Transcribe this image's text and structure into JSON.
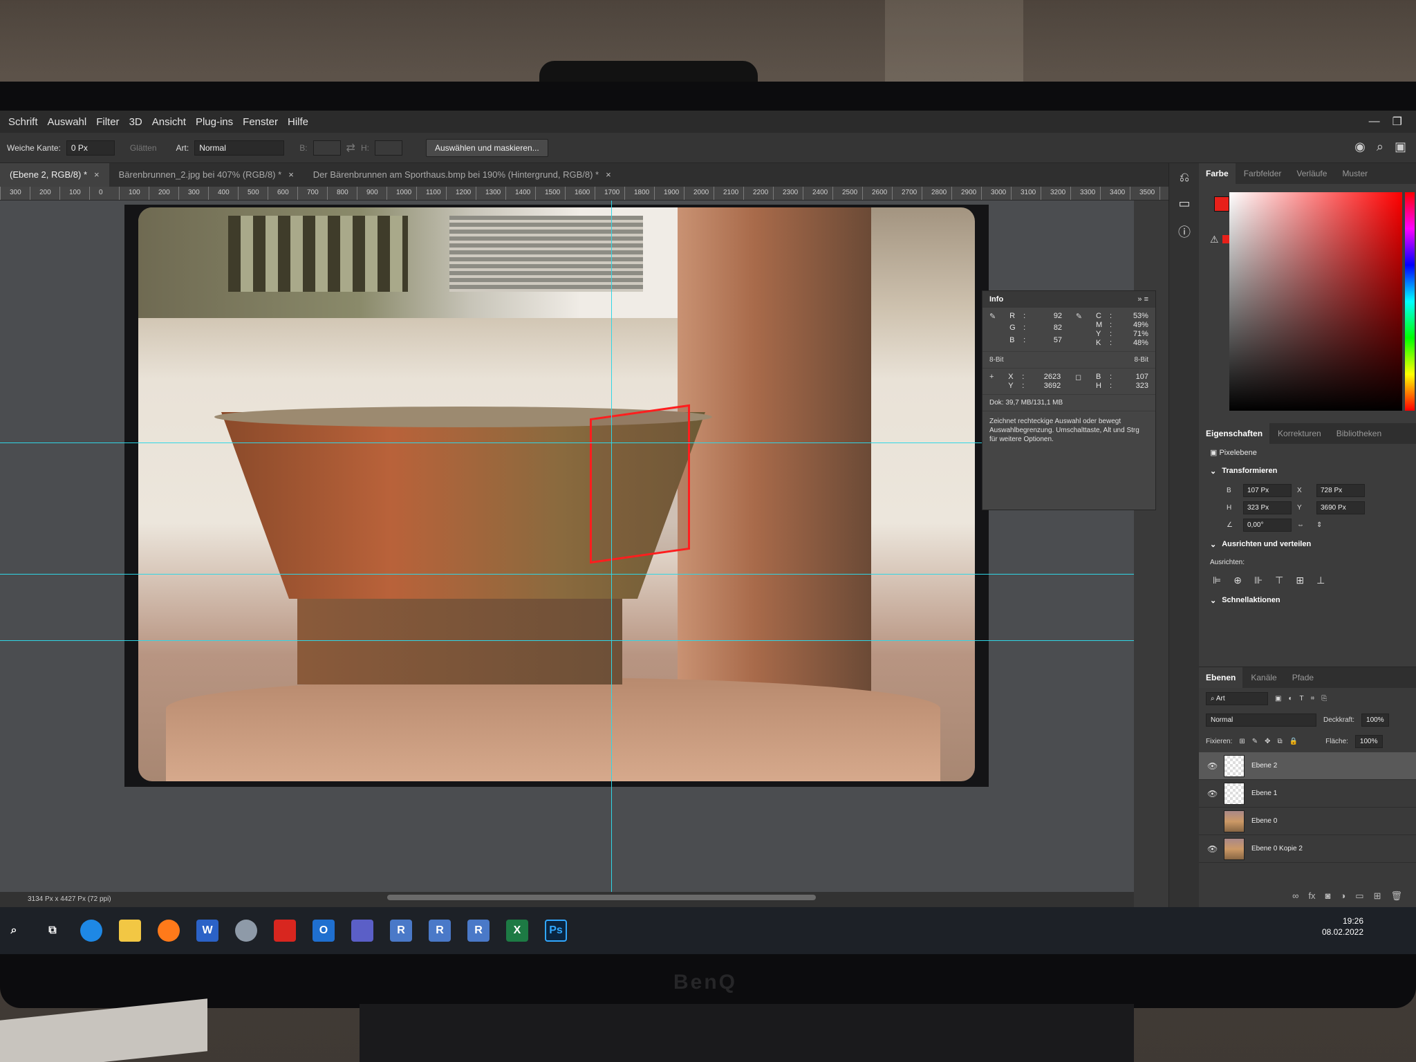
{
  "menu": [
    "Schrift",
    "Auswahl",
    "Filter",
    "3D",
    "Ansicht",
    "Plug-ins",
    "Fenster",
    "Hilfe"
  ],
  "options": {
    "feather_label": "Weiche Kante:",
    "feather_value": "0 Px",
    "smooth_label": "Glätten",
    "style_label": "Art:",
    "style_value": "Normal",
    "width_label": "B:",
    "height_label": "H:",
    "select_mask_button": "Auswählen und maskieren..."
  },
  "tabs": [
    {
      "label": "(Ebene 2, RGB/8) *",
      "active": true
    },
    {
      "label": "Bärenbrunnen_2.jpg bei 407% (RGB/8) *",
      "active": false
    },
    {
      "label": "Der Bärenbrunnen am Sporthaus.bmp bei 190% (Hintergrund, RGB/8) *",
      "active": false
    }
  ],
  "ruler_labels": [
    "300",
    "200",
    "100",
    "0",
    "100",
    "200",
    "300",
    "400",
    "500",
    "600",
    "700",
    "800",
    "900",
    "1000",
    "1100",
    "1200",
    "1300",
    "1400",
    "1500",
    "1600",
    "1700",
    "1800",
    "1900",
    "2000",
    "2100",
    "2200",
    "2300",
    "2400",
    "2500",
    "2600",
    "2700",
    "2800",
    "2900",
    "3000",
    "3100",
    "3200",
    "3300",
    "3400",
    "3500"
  ],
  "info": {
    "title": "Info",
    "rgb": [
      {
        "k": "R",
        "v": "92"
      },
      {
        "k": "G",
        "v": "82"
      },
      {
        "k": "B",
        "v": "57"
      }
    ],
    "cmyk": [
      {
        "k": "C",
        "v": "53%"
      },
      {
        "k": "M",
        "v": "49%"
      },
      {
        "k": "Y",
        "v": "71%"
      },
      {
        "k": "K",
        "v": "48%"
      }
    ],
    "bit_left": "8-Bit",
    "bit_right": "8-Bit",
    "xy": [
      {
        "k": "X",
        "v": "2623"
      },
      {
        "k": "Y",
        "v": "3692"
      }
    ],
    "wh": [
      {
        "k": "B",
        "v": "107"
      },
      {
        "k": "H",
        "v": "323"
      }
    ],
    "doc": "Dok: 39,7 MB/131,1 MB",
    "hint": "Zeichnet rechteckige Auswahl oder bewegt Auswahlbegrenzung. Umschalttaste, Alt und Strg für weitere Optionen."
  },
  "status": {
    "size": "3134 Px x 4427 Px (72 ppi)"
  },
  "color_panel": {
    "tabs": [
      "Farbe",
      "Farbfelder",
      "Verläufe",
      "Muster"
    ],
    "foreground": "#e8201a"
  },
  "properties": {
    "tabs": [
      "Eigenschaften",
      "Korrekturen",
      "Bibliotheken"
    ],
    "type": "Pixelebene",
    "transform_title": "Transformieren",
    "w_label": "B",
    "w": "107 Px",
    "x_label": "X",
    "x": "728 Px",
    "h_label": "H",
    "h": "323 Px",
    "y_label": "Y",
    "y": "3690 Px",
    "angle": "0,00°",
    "align_title": "Ausrichten und verteilen",
    "align_label": "Ausrichten:",
    "quick_title": "Schnellaktionen"
  },
  "layers": {
    "tabs": [
      "Ebenen",
      "Kanäle",
      "Pfade"
    ],
    "filter": "Art",
    "blend": "Normal",
    "opacity_label": "Deckkraft:",
    "opacity": "100%",
    "lock_label": "Fixieren:",
    "fill_label": "Fläche:",
    "fill": "100%",
    "items": [
      {
        "name": "Ebene 2",
        "visible": true,
        "selected": true
      },
      {
        "name": "Ebene 1",
        "visible": true,
        "selected": false
      },
      {
        "name": "Ebene 0",
        "visible": false,
        "selected": false
      },
      {
        "name": "Ebene 0 Kopie 2",
        "visible": true,
        "selected": false
      }
    ]
  },
  "taskbar": {
    "time": "19:26",
    "date": "08.02.2022"
  },
  "monitor_brand": "BenQ"
}
